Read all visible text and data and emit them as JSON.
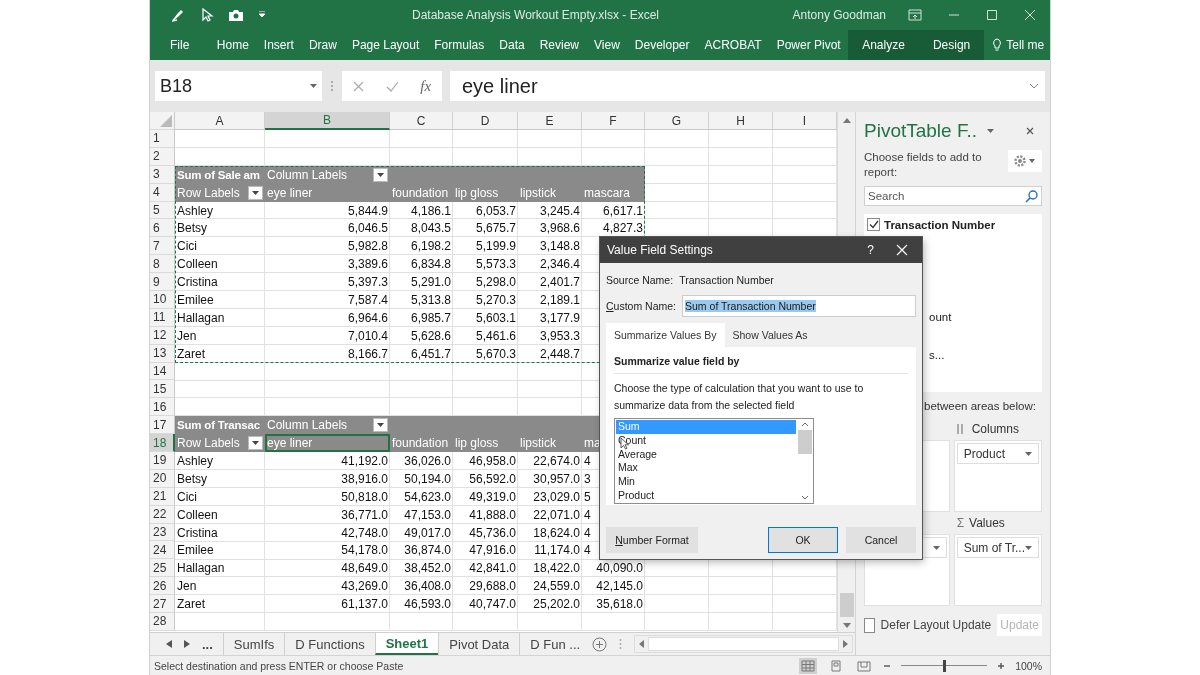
{
  "window": {
    "title": "Database Analysis Workout Empty.xlsx  -  Excel",
    "user": "Antony Goodman"
  },
  "ribbon_tabs": [
    {
      "label": "File",
      "contextual": false
    },
    {
      "label": "Home",
      "contextual": false
    },
    {
      "label": "Insert",
      "contextual": false
    },
    {
      "label": "Draw",
      "contextual": false
    },
    {
      "label": "Page Layout",
      "contextual": false
    },
    {
      "label": "Formulas",
      "contextual": false
    },
    {
      "label": "Data",
      "contextual": false
    },
    {
      "label": "Review",
      "contextual": false
    },
    {
      "label": "View",
      "contextual": false
    },
    {
      "label": "Developer",
      "contextual": false
    },
    {
      "label": "ACROBAT",
      "contextual": false
    },
    {
      "label": "Power Pivot",
      "contextual": false
    },
    {
      "label": "Analyze",
      "contextual": true
    },
    {
      "label": "Design",
      "contextual": true
    }
  ],
  "tell_me": "Tell me",
  "formula_bar": {
    "name_box": "B18",
    "function_label": "fx",
    "formula": "eye liner"
  },
  "sheet": {
    "columns": [
      {
        "label": "A",
        "selected": false
      },
      {
        "label": "B",
        "selected": true
      },
      {
        "label": "C",
        "selected": false
      },
      {
        "label": "D",
        "selected": false
      },
      {
        "label": "E",
        "selected": false
      },
      {
        "label": "F",
        "selected": false
      },
      {
        "label": "G",
        "selected": false
      },
      {
        "label": "H",
        "selected": false
      },
      {
        "label": "I",
        "selected": false
      }
    ],
    "rows": [
      {
        "number": "1",
        "selected": false,
        "kind": "blank"
      },
      {
        "number": "2",
        "selected": false,
        "kind": "blank"
      },
      {
        "number": "3",
        "selected": false,
        "kind": "pivot_title",
        "cells": {
          "A": "Sum of Sale am",
          "B": {
            "text": "Column Labels",
            "filter": true
          }
        }
      },
      {
        "number": "4",
        "selected": false,
        "kind": "pivot_labels",
        "cells": {
          "A": {
            "text": "Row Labels",
            "filter": true
          },
          "B": "eye liner",
          "C": "foundation",
          "D": "lip gloss",
          "E": "lipstick",
          "F": "mascara"
        }
      },
      {
        "number": "5",
        "selected": false,
        "kind": "data",
        "cells": {
          "A": "Ashley",
          "B": "5,844.9",
          "C": "4,186.1",
          "D": "6,053.7",
          "E": "3,245.4",
          "F": "6,617.1"
        }
      },
      {
        "number": "6",
        "selected": false,
        "kind": "data",
        "cells": {
          "A": "Betsy",
          "B": "6,046.5",
          "C": "8,043.5",
          "D": "5,675.7",
          "E": "3,968.6",
          "F": "4,827.3"
        }
      },
      {
        "number": "7",
        "selected": false,
        "kind": "data",
        "cells": {
          "A": "Cici",
          "B": "5,982.8",
          "C": "6,198.2",
          "D": "5,199.9",
          "E": "3,148.8"
        }
      },
      {
        "number": "8",
        "selected": false,
        "kind": "data",
        "cells": {
          "A": "Colleen",
          "B": "3,389.6",
          "C": "6,834.8",
          "D": "5,573.3",
          "E": "2,346.4"
        }
      },
      {
        "number": "9",
        "selected": false,
        "kind": "data",
        "cells": {
          "A": "Cristina",
          "B": "5,397.3",
          "C": "5,291.0",
          "D": "5,298.0",
          "E": "2,401.7"
        }
      },
      {
        "number": "10",
        "selected": false,
        "kind": "data",
        "cells": {
          "A": "Emilee",
          "B": "7,587.4",
          "C": "5,313.8",
          "D": "5,270.3",
          "E": "2,189.1"
        }
      },
      {
        "number": "11",
        "selected": false,
        "kind": "data",
        "cells": {
          "A": "Hallagan",
          "B": "6,964.6",
          "C": "6,985.7",
          "D": "5,603.1",
          "E": "3,177.9"
        }
      },
      {
        "number": "12",
        "selected": false,
        "kind": "data",
        "cells": {
          "A": "Jen",
          "B": "7,010.4",
          "C": "5,628.6",
          "D": "5,461.6",
          "E": "3,953.3"
        }
      },
      {
        "number": "13",
        "selected": false,
        "kind": "data",
        "cells": {
          "A": "Zaret",
          "B": "8,166.7",
          "C": "6,451.7",
          "D": "5,670.3",
          "E": "2,448.7"
        }
      },
      {
        "number": "14",
        "selected": false,
        "kind": "blank"
      },
      {
        "number": "15",
        "selected": false,
        "kind": "blank"
      },
      {
        "number": "16",
        "selected": false,
        "kind": "blank"
      },
      {
        "number": "17",
        "selected": false,
        "kind": "pivot_title",
        "cells": {
          "A": "Sum of Transac",
          "B": {
            "text": "Column Labels",
            "filter": true
          }
        }
      },
      {
        "number": "18",
        "selected": true,
        "kind": "pivot_labels",
        "cells": {
          "A": {
            "text": "Row Labels",
            "filter": true
          },
          "B": "eye liner",
          "C": "foundation",
          "D": "lip gloss",
          "E": "lipstick",
          "F": "ma"
        }
      },
      {
        "number": "19",
        "selected": false,
        "kind": "data",
        "cells": {
          "A": "Ashley",
          "B": "41,192.0",
          "C": "36,026.0",
          "D": "46,958.0",
          "E": "22,674.0",
          "F": "4"
        }
      },
      {
        "number": "20",
        "selected": false,
        "kind": "data",
        "cells": {
          "A": "Betsy",
          "B": "38,916.0",
          "C": "50,194.0",
          "D": "56,592.0",
          "E": "30,957.0",
          "F": "3"
        }
      },
      {
        "number": "21",
        "selected": false,
        "kind": "data",
        "cells": {
          "A": "Cici",
          "B": "50,818.0",
          "C": "54,623.0",
          "D": "49,319.0",
          "E": "23,029.0",
          "F": "5"
        }
      },
      {
        "number": "22",
        "selected": false,
        "kind": "data",
        "cells": {
          "A": "Colleen",
          "B": "36,771.0",
          "C": "47,153.0",
          "D": "41,888.0",
          "E": "22,071.0",
          "F": "4"
        }
      },
      {
        "number": "23",
        "selected": false,
        "kind": "data",
        "cells": {
          "A": "Cristina",
          "B": "42,748.0",
          "C": "49,017.0",
          "D": "45,736.0",
          "E": "18,624.0",
          "F": "4"
        }
      },
      {
        "number": "24",
        "selected": false,
        "kind": "data",
        "cells": {
          "A": "Emilee",
          "B": "54,178.0",
          "C": "36,874.0",
          "D": "47,916.0",
          "E": "11,174.0",
          "F": "4"
        }
      },
      {
        "number": "25",
        "selected": false,
        "kind": "data",
        "cells": {
          "A": "Hallagan",
          "B": "48,649.0",
          "C": "38,452.0",
          "D": "42,841.0",
          "E": "18,422.0",
          "F": "40,090.0"
        }
      },
      {
        "number": "26",
        "selected": false,
        "kind": "data",
        "cells": {
          "A": "Jen",
          "B": "43,269.0",
          "C": "36,408.0",
          "D": "29,688.0",
          "E": "24,559.0",
          "F": "42,145.0"
        }
      },
      {
        "number": "27",
        "selected": false,
        "kind": "data",
        "cells": {
          "A": "Zaret",
          "B": "61,137.0",
          "C": "46,593.0",
          "D": "40,747.0",
          "E": "25,202.0",
          "F": "35,618.0"
        }
      },
      {
        "number": "28",
        "selected": false,
        "kind": "blank"
      }
    ]
  },
  "sheet_tabs": {
    "overflow": "...",
    "tabs": [
      {
        "label": "SumIfs",
        "selected": false
      },
      {
        "label": "D Functions",
        "selected": false
      },
      {
        "label": "Sheet1",
        "selected": true
      },
      {
        "label": "Pivot Data",
        "selected": false
      },
      {
        "label": "D Fun ...",
        "selected": false
      }
    ]
  },
  "status_bar": {
    "message": "Select destination and press ENTER or choose Paste",
    "views": [
      {
        "kind": "normal",
        "selected": true
      },
      {
        "kind": "page_layout",
        "selected": false
      },
      {
        "kind": "page_break",
        "selected": false
      }
    ],
    "zoom": {
      "level": 0.5,
      "reading": "100%"
    }
  },
  "pivot_panel": {
    "title": "PivotTable F..",
    "instruction": "Choose fields to add to report:",
    "search": {
      "placeholder": "Search"
    },
    "fields": [
      {
        "kind": "field",
        "label": "Transaction Number",
        "checked": true
      },
      {
        "kind": "partial",
        "label": "ount"
      },
      {
        "kind": "partial",
        "label": "s..."
      }
    ],
    "drag_hint": "between areas below:",
    "columns_area": {
      "label": "Columns",
      "items": [
        "Product"
      ]
    },
    "values_area": {
      "icon": "Σ",
      "label": "Values",
      "items": [
        "Sum of Tr..."
      ]
    },
    "defer": {
      "label": "Defer Layout Update",
      "checked": false
    },
    "update_button": {
      "label": "Update",
      "disabled": true
    }
  },
  "dialog": {
    "title": "Value Field Settings",
    "help": "?",
    "source_label": "Source Name:",
    "source_value": "Transaction Number",
    "custom_label": "Custom Name:",
    "custom_value": "Sum of Transaction Number",
    "tabs": [
      {
        "label": "Summarize Values By",
        "selected": true
      },
      {
        "label": "Show Values As",
        "selected": false
      }
    ],
    "section_title": "Summarize value field by",
    "description": "Choose the type of calculation that you want to use to summarize data from the selected field",
    "functions": [
      {
        "label": "Sum",
        "selected": true
      },
      {
        "label": "Count",
        "selected": false
      },
      {
        "label": "Average",
        "selected": false
      },
      {
        "label": "Max",
        "selected": false
      },
      {
        "label": "Min",
        "selected": false
      },
      {
        "label": "Product",
        "selected": false
      }
    ],
    "buttons": [
      {
        "label": "Number Format",
        "kind": "secondary"
      },
      {
        "label": "OK",
        "kind": "default"
      },
      {
        "label": "Cancel",
        "kind": "secondary"
      }
    ]
  }
}
